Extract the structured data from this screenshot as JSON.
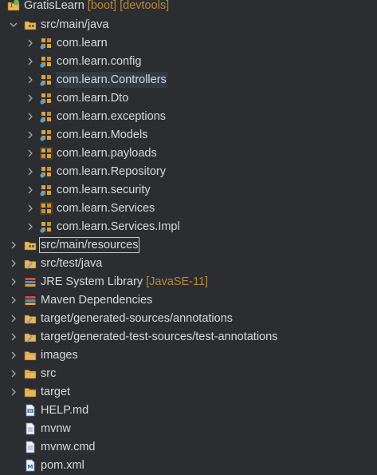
{
  "tree": {
    "project": {
      "name": "GratisLearn",
      "decoration": "[boot] [devtools]"
    },
    "src_main_java": {
      "label": "src/main/java",
      "packages": [
        {
          "label": "com.learn"
        },
        {
          "label": "com.learn.config"
        },
        {
          "label": "com.learn.Controllers"
        },
        {
          "label": "com.learn.Dto"
        },
        {
          "label": "com.learn.exceptions"
        },
        {
          "label": "com.learn.Models"
        },
        {
          "label": "com.learn.payloads"
        },
        {
          "label": "com.learn.Repository"
        },
        {
          "label": "com.learn.security"
        },
        {
          "label": "com.learn.Services"
        },
        {
          "label": "com.learn.Services.Impl"
        }
      ]
    },
    "src_main_resources": {
      "label": "src/main/resources"
    },
    "src_test_java": {
      "label": "src/test/java"
    },
    "jre": {
      "label": "JRE System Library",
      "decoration": "[JavaSE-11]"
    },
    "maven": {
      "label": "Maven Dependencies"
    },
    "gen_sources": {
      "label": "target/generated-sources/annotations"
    },
    "gen_test_sources": {
      "label": "target/generated-test-sources/test-annotations"
    },
    "images": {
      "label": "images"
    },
    "src": {
      "label": "src"
    },
    "target": {
      "label": "target"
    },
    "files": [
      {
        "label": "HELP.md"
      },
      {
        "label": "mvnw"
      },
      {
        "label": "mvnw.cmd"
      },
      {
        "label": "pom.xml"
      }
    ]
  },
  "colors": {
    "background": "#2b2d30",
    "text": "#d9d9d9",
    "decoration": "#b48a3c",
    "selection": "#2f3b46"
  }
}
